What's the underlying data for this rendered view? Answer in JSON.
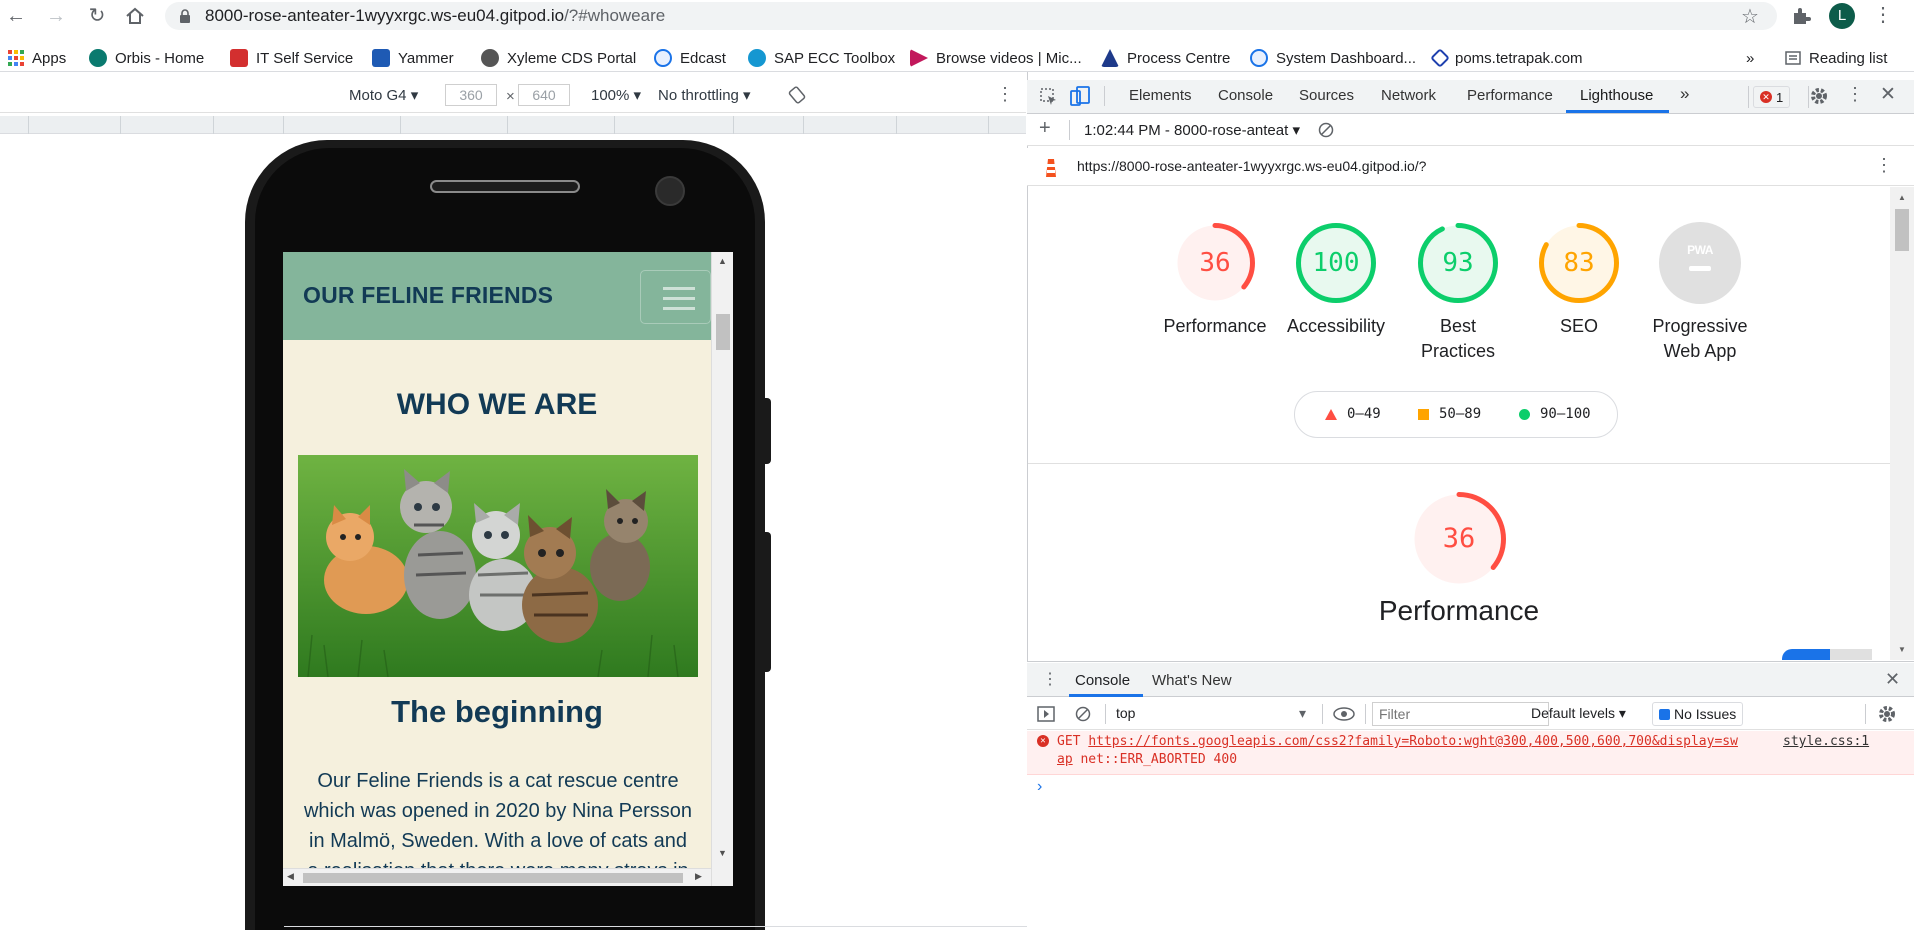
{
  "browser": {
    "url_host": "8000-rose-anteater-1wyyxrgc.ws-eu04.gitpod.io",
    "url_path": "/?#whoweare",
    "profile_initial": "L"
  },
  "bookmarks": [
    {
      "label": "Apps",
      "color": "#ea4335"
    },
    {
      "label": "Orbis - Home",
      "color": "#0a7a6f"
    },
    {
      "label": "IT Self Service",
      "color": "#d32f2f"
    },
    {
      "label": "Yammer",
      "color": "#1e5ab4"
    },
    {
      "label": "Xyleme CDS Portal",
      "color": "#555555"
    },
    {
      "label": "Edcast",
      "color": "#1a73e8"
    },
    {
      "label": "SAP ECC Toolbox",
      "color": "#1597d1"
    },
    {
      "label": "Browse videos | Mic...",
      "color": "#c2185b"
    },
    {
      "label": "Process Centre",
      "color": "#1e3a8a"
    },
    {
      "label": "System Dashboard...",
      "color": "#1a73e8"
    },
    {
      "label": "poms.tetrapak.com",
      "color": "#1e40af"
    }
  ],
  "bookmarks_more": "»",
  "reading_list": "Reading list",
  "device_toolbar": {
    "device": "Moto G4",
    "width": "360",
    "times": "×",
    "height": "640",
    "zoom": "100%",
    "throttling": "No throttling"
  },
  "site": {
    "brand": "OUR FELINE FRIENDS",
    "section_title": "WHO WE ARE",
    "subtitle": "The beginning",
    "body": "Our Feline Friends is a cat rescue centre which was opened in 2020 by Nina Persson in Malmö, Sweden. With a love of cats and a realisation that there were many strays in"
  },
  "devtools": {
    "tabs": [
      "Elements",
      "Console",
      "Sources",
      "Network",
      "Performance",
      "Lighthouse"
    ],
    "active_tab": "Lighthouse",
    "more": "»",
    "error_count": "1",
    "report_select": "1:02:44 PM - 8000-rose-anteat",
    "report_url": "https://8000-rose-anteater-1wyyxrgc.ws-eu04.gitpod.io/?",
    "gauges": [
      {
        "score": "36",
        "label": "Performance",
        "value": 36,
        "color": "#ff4e42",
        "fill": "#fff1f0"
      },
      {
        "score": "100",
        "label": "Accessibility",
        "value": 100,
        "color": "#0cce6b",
        "fill": "#e8f9ef"
      },
      {
        "score": "93",
        "label": "Best Practices",
        "value": 93,
        "color": "#0cce6b",
        "fill": "#e8f9ef"
      },
      {
        "score": "83",
        "label": "SEO",
        "value": 83,
        "color": "#ffa400",
        "fill": "#fff6e6"
      }
    ],
    "pwa_label": "Progressive Web App",
    "pwa_badge": "PWA",
    "legend": [
      {
        "range": "0–49",
        "color": "#ff4e42"
      },
      {
        "range": "50–89",
        "color": "#ffa400"
      },
      {
        "range": "90–100",
        "color": "#0cce6b"
      }
    ],
    "perf_big": {
      "score": "36",
      "title": "Performance",
      "value": 36
    }
  },
  "console": {
    "tabs": [
      "Console",
      "What's New"
    ],
    "context": "top",
    "filter_placeholder": "Filter",
    "levels": "Default levels",
    "issues": "No Issues",
    "error_method": "GET",
    "error_url": "https://fonts.googleapis.com/css2?family=Roboto:wght@300,400,500,600,700&display=sw",
    "error_url_cont": "ap",
    "error_source": "style.css:1",
    "error_status": "net::ERR_ABORTED 400",
    "prompt": "›"
  }
}
